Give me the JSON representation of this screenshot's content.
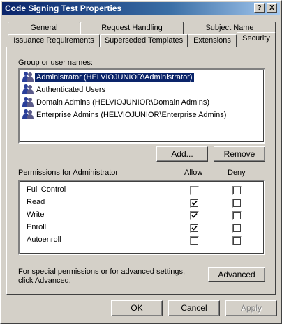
{
  "window": {
    "title": "Code Signing Test Properties"
  },
  "titlebar_buttons": {
    "help": "?",
    "close": "X"
  },
  "tabs": {
    "row_back": [
      "General",
      "Request Handling",
      "Subject Name"
    ],
    "row_front": [
      "Issuance Requirements",
      "Superseded Templates",
      "Extensions",
      "Security"
    ],
    "active": "Security"
  },
  "security": {
    "group_label": "Group or user names:",
    "users": [
      "Administrator (HELVIOJUNIOR\\Administrator)",
      "Authenticated Users",
      "Domain Admins (HELVIOJUNIOR\\Domain Admins)",
      "Enterprise Admins (HELVIOJUNIOR\\Enterprise Admins)"
    ],
    "selected_user_index": 0,
    "add_button": "Add...",
    "remove_button": "Remove",
    "permissions_label": "Permissions for Administrator",
    "allow_header": "Allow",
    "deny_header": "Deny",
    "permissions": [
      {
        "name": "Full Control",
        "allow": false,
        "deny": false
      },
      {
        "name": "Read",
        "allow": true,
        "deny": false
      },
      {
        "name": "Write",
        "allow": true,
        "deny": false
      },
      {
        "name": "Enroll",
        "allow": true,
        "deny": false
      },
      {
        "name": "Autoenroll",
        "allow": false,
        "deny": false
      }
    ],
    "advanced_text": "For special permissions or for advanced settings, click Advanced.",
    "advanced_button": "Advanced"
  },
  "footer": {
    "ok": "OK",
    "cancel": "Cancel",
    "apply": "Apply"
  },
  "colors": {
    "title_active": "#0a246a",
    "face": "#d4d0c8",
    "selection": "#0a246a"
  }
}
